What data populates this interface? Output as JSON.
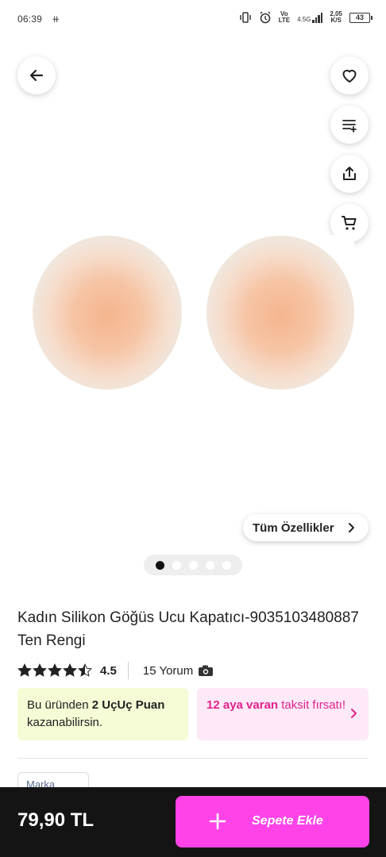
{
  "status_bar": {
    "time": "06:39",
    "network_top": "Vo",
    "network_bottom": "LTE",
    "net_type": "4.5G",
    "speed_top": "2,05",
    "speed_bottom": "K/S",
    "battery": "43"
  },
  "product": {
    "title": "Kadın Silikon Göğüs Ucu Kapatıcı-9035103480887 Ten Rengi",
    "features_label": "Tüm Özellikler",
    "image_count": 5,
    "active_image": 1,
    "rating": "4.5",
    "rating_value": 4.5,
    "reviews": "15 Yorum"
  },
  "points_card": {
    "prefix": "Bu üründen ",
    "points": "2 UçUç Puan",
    "suffix": " kazanabilirsin."
  },
  "installment_card": {
    "highlight": "12 aya varan",
    "suffix": " taksit fırsatı!"
  },
  "brand_chip": {
    "label": "Marka"
  },
  "bottom_bar": {
    "price": "79,90 TL",
    "add_to_cart_label": "Sepete Ekle"
  },
  "colors": {
    "accent_pink": "#ff43e9",
    "installment_text": "#e0238d",
    "points_bg": "#f4fbd5",
    "installment_bg": "#fde9f8",
    "bottom_bar_bg": "#141414"
  },
  "icons": {
    "back": "arrow-left-icon",
    "favorite": "heart-icon",
    "add_to_list": "list-add-icon",
    "share": "share-icon",
    "cart": "cart-icon"
  }
}
